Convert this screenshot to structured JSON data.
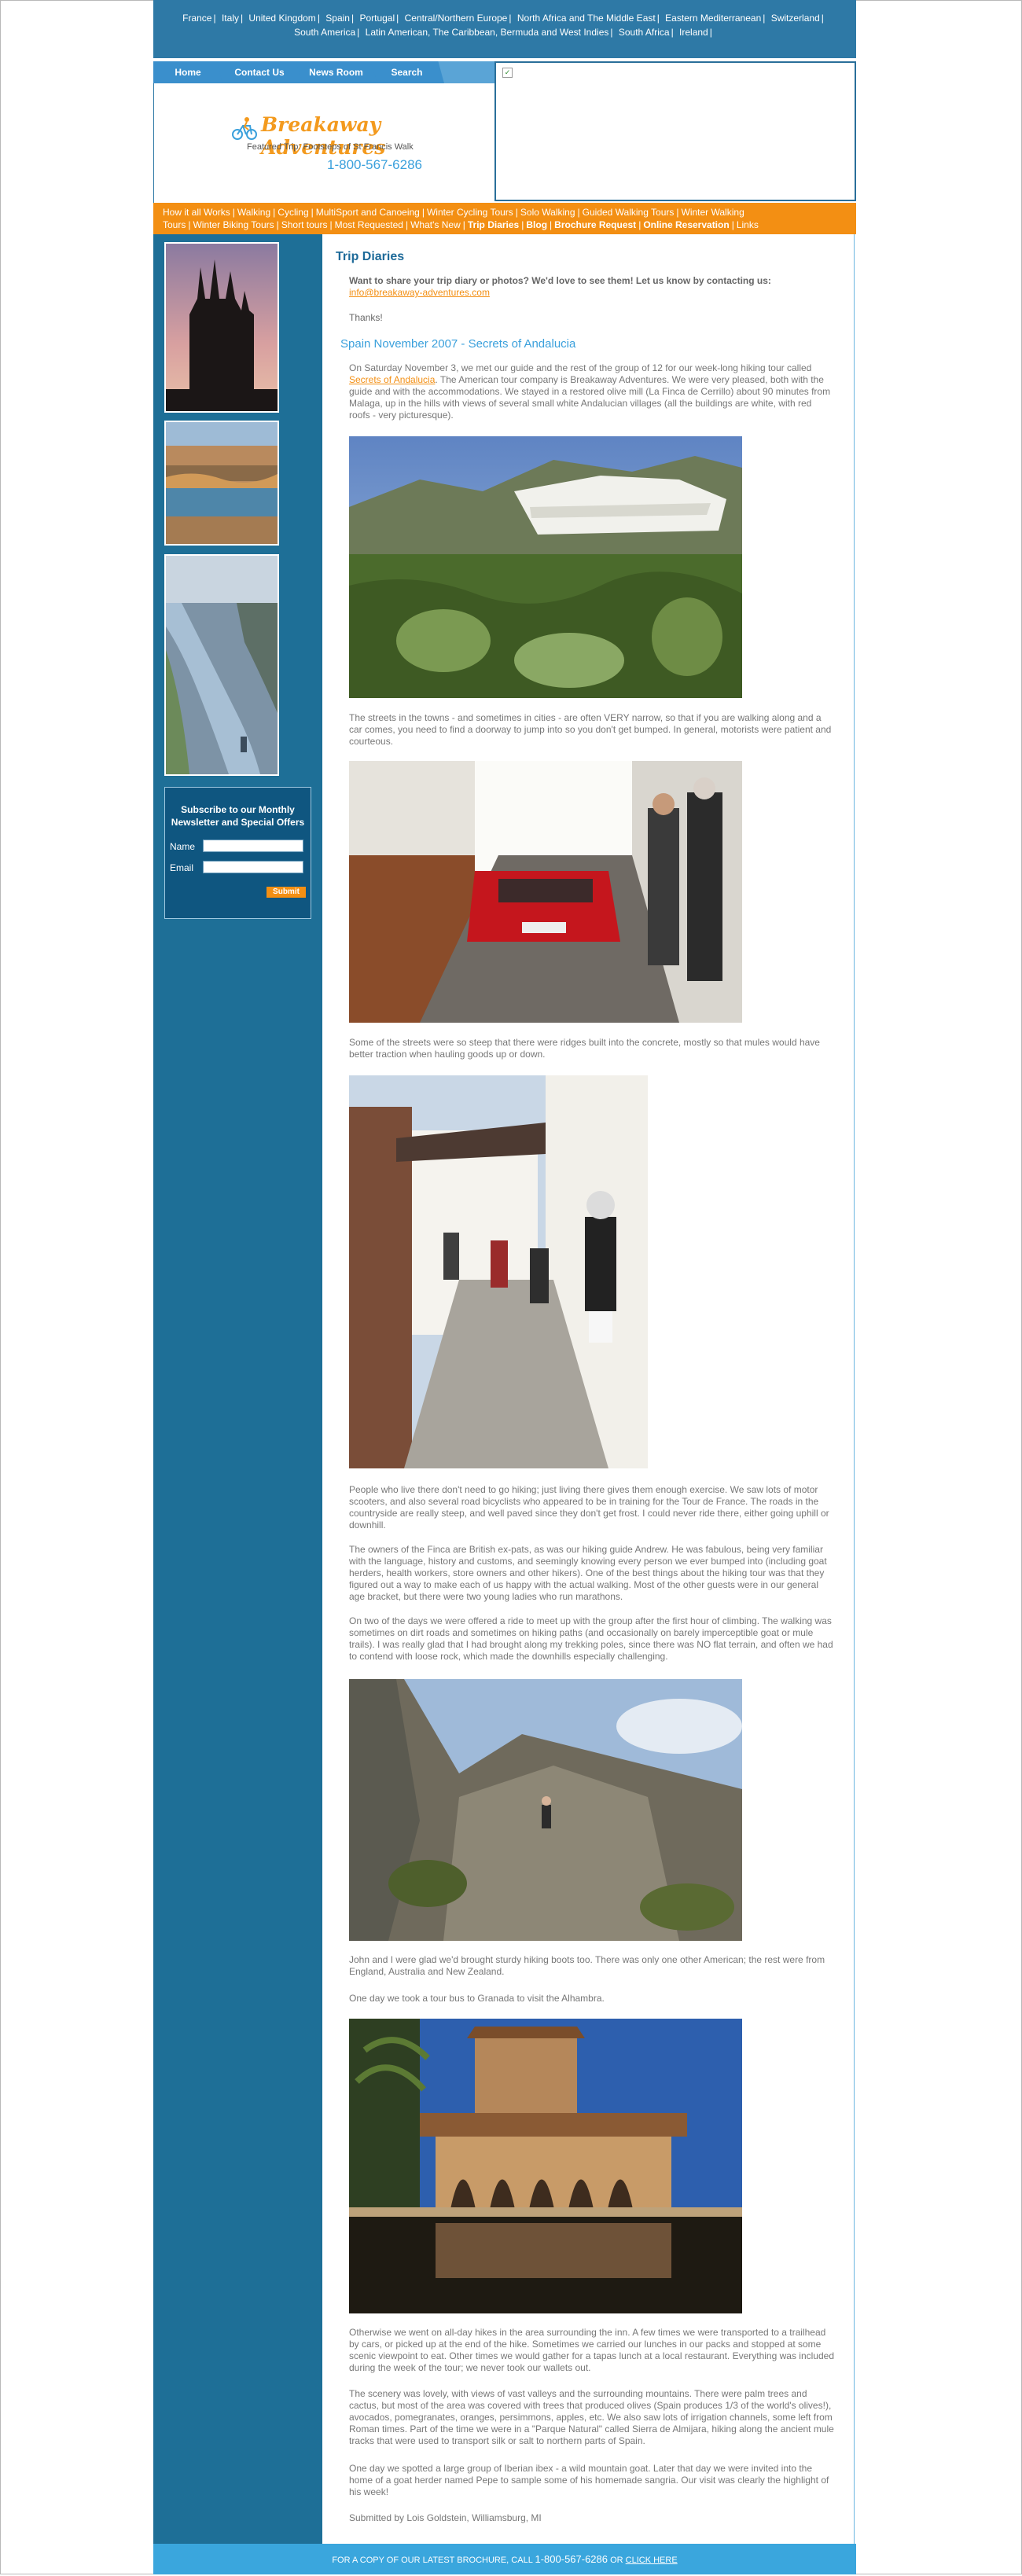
{
  "top_countries": [
    {
      "label": "France"
    },
    {
      "label": "Italy"
    },
    {
      "label": "United Kingdom"
    },
    {
      "label": "Spain"
    },
    {
      "label": "Portugal"
    },
    {
      "label": "Central/Northern Europe"
    },
    {
      "label": "North Africa and The Middle East"
    },
    {
      "label": "Eastern Mediterranean"
    },
    {
      "label": "Switzerland"
    },
    {
      "label": "South America"
    },
    {
      "label": "Latin American, The Caribbean, Bermuda and West Indies"
    },
    {
      "label": "South Africa"
    },
    {
      "label": "Ireland"
    }
  ],
  "nav_tabs": {
    "home": "Home",
    "contact": "Contact Us",
    "news": "News Room",
    "search": "Search"
  },
  "logo": {
    "name": "Breakaway Adventures",
    "tagline": "Featured Trip: Footsteps of St Francis Walk",
    "phone": "1-800-567-6286"
  },
  "orange_nav": [
    {
      "label": "How it all Works",
      "bold": false
    },
    {
      "label": "Walking",
      "bold": false
    },
    {
      "label": "Cycling",
      "bold": false
    },
    {
      "label": "MultiSport and Canoeing",
      "bold": false
    },
    {
      "label": "Winter Cycling Tours",
      "bold": false
    },
    {
      "label": "Solo Walking",
      "bold": false
    },
    {
      "label": "Guided Walking Tours",
      "bold": false
    },
    {
      "label": "Winter Walking Tours",
      "bold": false
    },
    {
      "label": "Winter Biking Tours",
      "bold": false
    },
    {
      "label": "Short tours",
      "bold": false
    },
    {
      "label": "Most Requested",
      "bold": false
    },
    {
      "label": "What's New",
      "bold": false
    },
    {
      "label": "Trip Diaries",
      "bold": true
    },
    {
      "label": "Blog",
      "bold": true
    },
    {
      "label": "Brochure Request",
      "bold": true
    },
    {
      "label": "Online Reservation",
      "bold": true
    },
    {
      "label": "Links",
      "bold": false
    }
  ],
  "newsletter": {
    "title": "Subscribe to our Monthly Newsletter and Special Offers",
    "name_label": "Name",
    "email_label": "Email",
    "submit": "Submit"
  },
  "content": {
    "page_title": "Trip Diaries",
    "share_intro": "Want to share your trip diary or photos? We'd love to see them! Let us know by contacting us:",
    "share_email": "info@breakaway-adventures.com",
    "thanks": "Thanks!",
    "diary_title": "Spain November 2007 - Secrets of Andalucia",
    "p1_before": "On Saturday November 3, we met our guide and the rest of the group of 12 for our week-long hiking tour called ",
    "p1_link": "Secrets of Andalucia",
    "p1_after": ". The American tour company is Breakaway Adventures. We were very pleased, both with the guide and with the accommodations. We stayed in a restored olive mill (La Finca de Cerrillo) about 90 minutes from Malaga, up in the hills with views of several small white Andalucian villages (all the buildings are white, with red roofs - very picturesque).",
    "p2": "The streets in the towns - and sometimes in cities - are often VERY narrow, so that if you are walking along and a car comes, you need to find a doorway to jump into so you don't get bumped. In general, motorists were patient and courteous.",
    "p3": "Some of the streets were so steep that there were ridges built into the concrete, mostly so that mules would have better traction when hauling goods up or down.",
    "p4": "People who live there don't need to go hiking; just living there gives them enough exercise. We saw lots of motor scooters, and also several road bicyclists who appeared to be in training for the Tour de France. The roads in the countryside are really steep, and well paved since they don't get frost. I could never ride there, either going uphill or downhill.",
    "p5": "The owners of the Finca are British ex-pats, as was our hiking guide Andrew. He was fabulous, being very familiar with the language, history and customs, and seemingly knowing every person we ever bumped into (including goat herders, health workers, store owners and other hikers). One of the best things about the hiking tour was that they figured out a way to make each of us happy with the actual walking. Most of the other guests were in our general age bracket, but there were two young ladies who run marathons.",
    "p6": "On two of the days we were offered a ride to meet up with the group after the first hour of climbing. The walking was sometimes on dirt roads and sometimes on hiking paths (and occasionally on barely imperceptible goat or mule trails). I was really glad that I had brought along my trekking poles, since there was NO flat terrain, and often we had to contend with loose rock, which made the downhills especially challenging.",
    "p7": "John and I were glad we'd brought sturdy hiking boots too. There was only one other American; the rest were from England, Australia and New Zealand.",
    "p8": "One day we took a tour bus to Granada to visit the Alhambra.",
    "p9": "Otherwise we went on all-day hikes in the area surrounding the inn.  A few times we were transported to a trailhead by cars, or picked up at the end of the hike. Sometimes we carried our lunches in our packs and stopped at some scenic viewpoint to eat. Other times we would gather for a tapas lunch at a local restaurant. Everything was included during the week of the tour; we never took our wallets out.",
    "p10": "The scenery was lovely, with views of vast valleys and the surrounding mountains. There were palm trees and cactus, but most of the area was covered with trees that produced olives (Spain produces 1/3 of the world's olives!), avocados, pomegranates, oranges, persimmons, apples, etc. We also saw lots of irrigation channels, some left from Roman times. Part of the time we were in a \"Parque Natural\" called Sierra de Almijara, hiking along the ancient mule tracks that were used to transport silk or salt to northern parts of Spain.",
    "p11": "One day we spotted a large group of Iberian ibex - a wild mountain goat. Later that day we were invited into the home of a goat herder named Pepe to sample some of his homemade sangria. Our visit was clearly the highlight of his week!",
    "signed": "Submitted by Lois Goldstein, Williamsburg, MI"
  },
  "footer": {
    "prefix": "FOR A COPY OF OUR LATEST BROCHURE, CALL",
    "phone": "1-800-567-6286",
    "middle": " OR ",
    "link": "CLICK HERE"
  },
  "colors": {
    "brand_blue": "#2e79a6",
    "sidebar_blue": "#1e6f97",
    "accent_orange": "#f38f13",
    "title_blue": "#1d6a99",
    "footer_blue": "#3aa6dd"
  }
}
